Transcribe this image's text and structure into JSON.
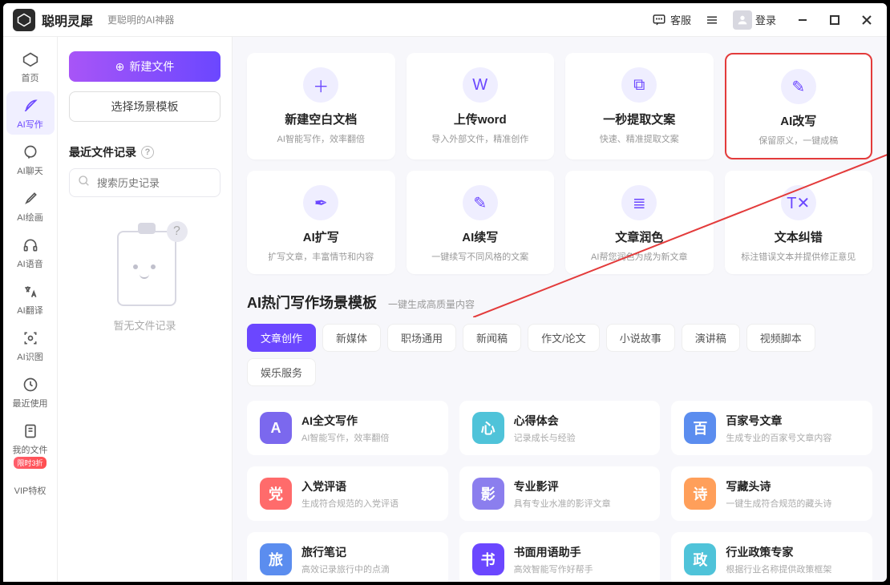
{
  "app": {
    "name": "聪明灵犀",
    "tagline": "更聪明的AI神器"
  },
  "header": {
    "support": "客服",
    "login": "登录"
  },
  "sidebar": [
    {
      "label": "首页"
    },
    {
      "label": "AI写作",
      "active": true
    },
    {
      "label": "AI聊天"
    },
    {
      "label": "AI绘画"
    },
    {
      "label": "AI语音"
    },
    {
      "label": "AI翻译"
    },
    {
      "label": "AI识图"
    },
    {
      "label": "最近使用"
    },
    {
      "label": "我的文件"
    },
    {
      "label": "VIP特权",
      "badge": "限时3折"
    }
  ],
  "mid": {
    "new_file": "新建文件",
    "choose_template": "选择场景模板",
    "recent_title": "最近文件记录",
    "search_placeholder": "搜索历史记录",
    "empty_text": "暂无文件记录"
  },
  "tools": [
    {
      "title": "新建空白文档",
      "sub": "AI智能写作，效率翻倍",
      "icon": "＋"
    },
    {
      "title": "上传word",
      "sub": "导入外部文件，精准创作",
      "icon": "W"
    },
    {
      "title": "一秒提取文案",
      "sub": "快速、精准提取文案",
      "icon": "⧉"
    },
    {
      "title": "AI改写",
      "sub": "保留原义，一键成稿",
      "icon": "✎",
      "highlight": true
    },
    {
      "title": "AI扩写",
      "sub": "扩写文章，丰富情节和内容",
      "icon": "✒"
    },
    {
      "title": "AI续写",
      "sub": "一键续写不同风格的文案",
      "icon": "✎"
    },
    {
      "title": "文章润色",
      "sub": "AI帮您润色为成为新文章",
      "icon": "≣"
    },
    {
      "title": "文本纠错",
      "sub": "标注错误文本并提供修正意见",
      "icon": "T✕"
    }
  ],
  "scene": {
    "title": "AI热门写作场景模板",
    "sub": "一键生成高质量内容",
    "tabs": [
      "文章创作",
      "新媒体",
      "职场通用",
      "新闻稿",
      "作文/论文",
      "小说故事",
      "演讲稿",
      "视频脚本",
      "娱乐服务"
    ],
    "cards": [
      {
        "title": "AI全文写作",
        "sub": "AI智能写作，效率翻倍",
        "color": "#7b68ee",
        "letter": "A"
      },
      {
        "title": "心得体会",
        "sub": "记录成长与经验",
        "color": "#4fc3d9",
        "letter": "心"
      },
      {
        "title": "百家号文章",
        "sub": "生成专业的百家号文章内容",
        "color": "#5b8def",
        "letter": "百"
      },
      {
        "title": "入党评语",
        "sub": "生成符合规范的入党评语",
        "color": "#ff6b6b",
        "letter": "党"
      },
      {
        "title": "专业影评",
        "sub": "具有专业水准的影评文章",
        "color": "#8b7eee",
        "letter": "影"
      },
      {
        "title": "写藏头诗",
        "sub": "一键生成符合规范的藏头诗",
        "color": "#ff9f5a",
        "letter": "诗"
      },
      {
        "title": "旅行笔记",
        "sub": "高效记录旅行中的点滴",
        "color": "#5b8def",
        "letter": "旅"
      },
      {
        "title": "书面用语助手",
        "sub": "高效智能写作好帮手",
        "color": "#6b47ff",
        "letter": "书"
      },
      {
        "title": "行业政策专家",
        "sub": "根据行业名称提供政策框架",
        "color": "#4fc3d9",
        "letter": "政"
      }
    ]
  }
}
